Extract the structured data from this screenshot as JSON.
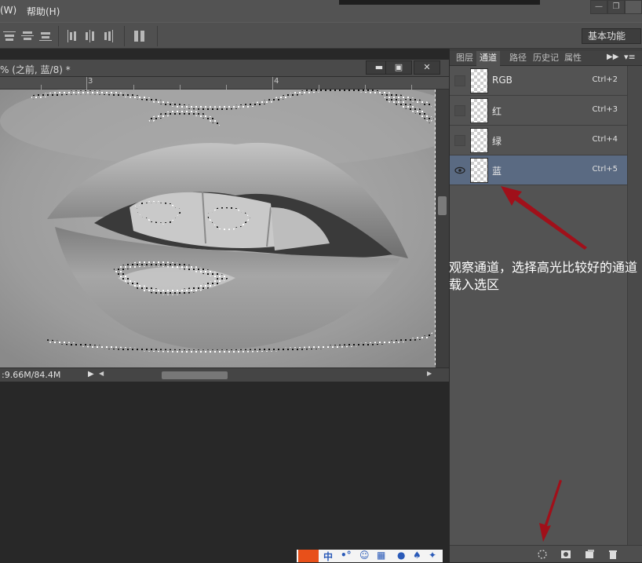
{
  "menu": {
    "items": [
      "(W)",
      "帮助(H)"
    ]
  },
  "options_bar": {
    "workspace_label": "基本功能"
  },
  "document": {
    "title": "% (之前, 蓝/8) *",
    "ruler_marks": [
      "3",
      "4"
    ],
    "status": ":9.66M/84.4M"
  },
  "panel": {
    "tabs": [
      "图层",
      "通道",
      "路径",
      "历史记",
      "属性"
    ],
    "active_tab": "通道",
    "channels": [
      {
        "name": "RGB",
        "shortcut": "Ctrl+2",
        "visible": false,
        "selected": false
      },
      {
        "name": "红",
        "shortcut": "Ctrl+3",
        "visible": false,
        "selected": false
      },
      {
        "name": "绿",
        "shortcut": "Ctrl+4",
        "visible": false,
        "selected": false
      },
      {
        "name": "蓝",
        "shortcut": "Ctrl+5",
        "visible": true,
        "selected": true
      }
    ]
  },
  "annotation": {
    "text": "观察通道，选择高光比较好的通道载入选区"
  },
  "colors": {
    "arrow": "#a0101a",
    "selected_row": "#5a6a82",
    "panel_bg": "#535353"
  }
}
